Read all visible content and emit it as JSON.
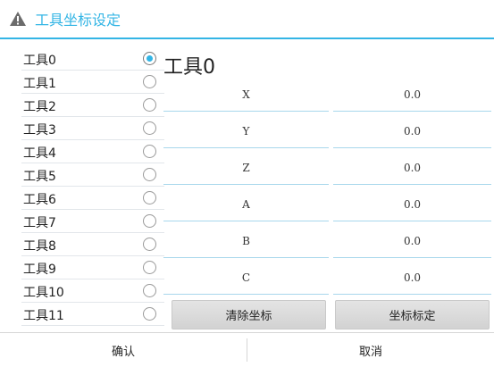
{
  "dialog": {
    "title": "工具坐标设定",
    "title_icon": "warning-icon",
    "accent_color": "#33b5e5"
  },
  "tools": [
    {
      "label": "工具0",
      "selected": true
    },
    {
      "label": "工具1",
      "selected": false
    },
    {
      "label": "工具2",
      "selected": false
    },
    {
      "label": "工具3",
      "selected": false
    },
    {
      "label": "工具4",
      "selected": false
    },
    {
      "label": "工具5",
      "selected": false
    },
    {
      "label": "工具6",
      "selected": false
    },
    {
      "label": "工具7",
      "selected": false
    },
    {
      "label": "工具8",
      "selected": false
    },
    {
      "label": "工具9",
      "selected": false
    },
    {
      "label": "工具10",
      "selected": false
    },
    {
      "label": "工具11",
      "selected": false
    }
  ],
  "current_tool": "工具0",
  "coordinates": [
    {
      "axis": "X",
      "value": "0.0"
    },
    {
      "axis": "Y",
      "value": "0.0"
    },
    {
      "axis": "Z",
      "value": "0.0"
    },
    {
      "axis": "A",
      "value": "0.0"
    },
    {
      "axis": "B",
      "value": "0.0"
    },
    {
      "axis": "C",
      "value": "0.0"
    }
  ],
  "actions": {
    "clear_label": "清除坐标",
    "calibrate_label": "坐标标定"
  },
  "footer": {
    "confirm_label": "确认",
    "cancel_label": "取消"
  }
}
